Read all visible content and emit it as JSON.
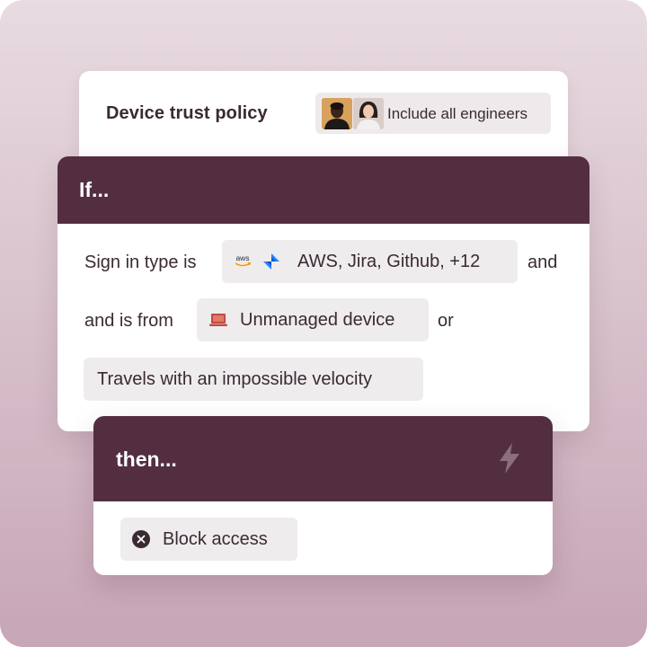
{
  "policy": {
    "title": "Device trust policy",
    "audience_label": "Include all engineers"
  },
  "condition": {
    "header": "If...",
    "row1": {
      "prefix": "Sign in type is",
      "chip_label": "AWS, Jira, Github, +12",
      "suffix": "and",
      "icons": [
        "aws-icon",
        "jira-icon"
      ],
      "aws_mark": "aws"
    },
    "row2": {
      "prefix": "and is from",
      "chip_label": "Unmanaged device",
      "suffix": "or",
      "icon": "laptop-icon"
    },
    "row3": {
      "chip_label": "Travels with an impossible velocity"
    }
  },
  "action": {
    "header": "then...",
    "icon": "lightning-bolt-icon",
    "chip_label": "Block access",
    "chip_icon": "close-circle-icon"
  },
  "colors": {
    "header_bg": "#532e40",
    "chip_bg": "#efecee",
    "text": "#3a2a33",
    "laptop_icon": "#c24a3c",
    "jira_blue": "#2684ff"
  }
}
